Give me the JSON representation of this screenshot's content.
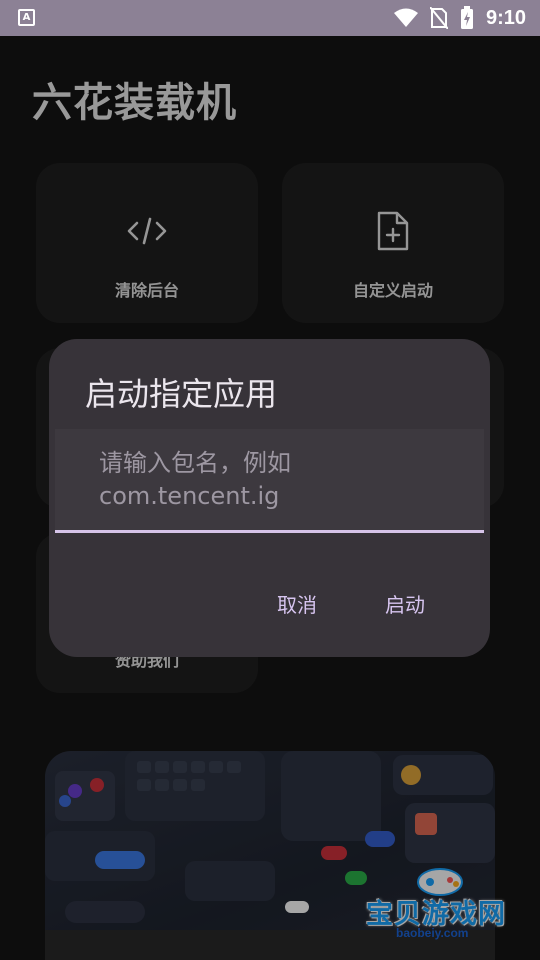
{
  "status_bar": {
    "app_icon": "A",
    "time": "9:10",
    "icons": [
      "wifi-icon",
      "no-sim-icon",
      "battery-charging-icon"
    ]
  },
  "app": {
    "title": "六花装载机"
  },
  "cards": {
    "clear_background": {
      "label": "清除后台",
      "icon": "code-icon"
    },
    "custom_launch": {
      "label": "自定义启动",
      "icon": "file-add-icon"
    },
    "sponsor_partial": {
      "label": "赞助我们"
    }
  },
  "dialog": {
    "title": "启动指定应用",
    "input_placeholder": "请输入包名，例如\ncom.tencent.ig",
    "cancel_label": "取消",
    "confirm_label": "启动"
  },
  "watermark": {
    "text": "宝贝游戏网",
    "sub": "baobeiy.com"
  },
  "colors": {
    "status_bar": "#8c8195",
    "accent": "#d7c5f0",
    "dialog_bg": "#373339",
    "card_bg": "#202020"
  }
}
